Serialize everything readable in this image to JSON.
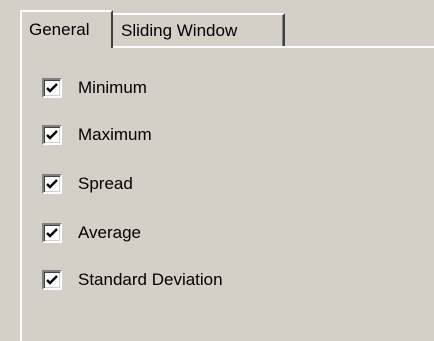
{
  "tabs": {
    "general": "General",
    "sliding_window": "Sliding Window"
  },
  "options": [
    {
      "label": "Minimum",
      "checked": true
    },
    {
      "label": "Maximum",
      "checked": true
    },
    {
      "label": "Spread",
      "checked": true
    },
    {
      "label": "Average",
      "checked": true
    },
    {
      "label": "Standard Deviation",
      "checked": true
    }
  ],
  "colors": {
    "face": "#d4d0c8",
    "highlight": "#ffffff",
    "shadow": "#808080",
    "dark_shadow": "#404040"
  }
}
